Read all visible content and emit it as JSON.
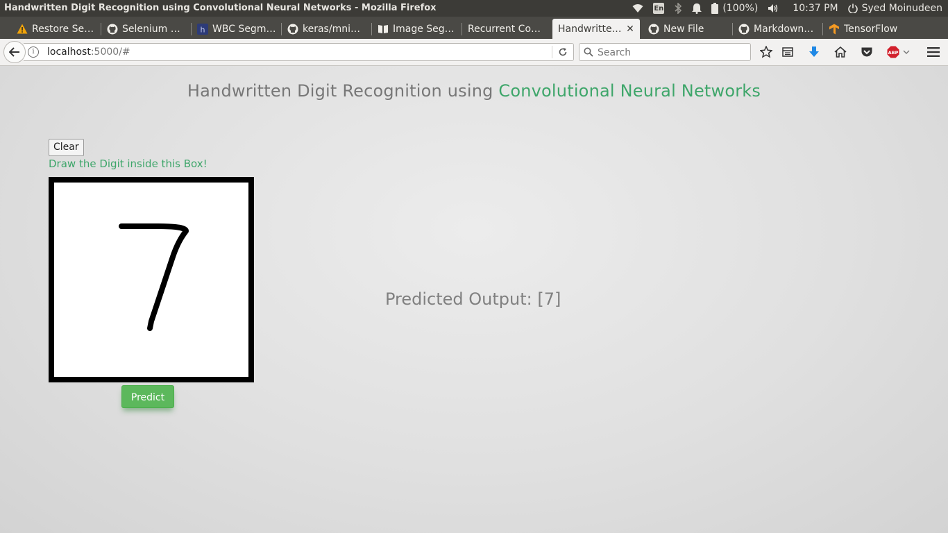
{
  "window": {
    "title": "Handwritten Digit Recognition using Convolutional Neural Networks - Mozilla Firefox"
  },
  "indicators": {
    "keyboard_layout": "En",
    "battery_percent": "(100%)",
    "time": "10:37 PM",
    "user": "Syed Moinudeen",
    "icons": [
      "wifi-icon",
      "keyboard-icon",
      "bluetooth-icon",
      "bell-icon",
      "battery-icon",
      "volume-icon",
      "power-icon"
    ]
  },
  "tabs": [
    {
      "label": "Restore Se…",
      "icon": "warning-icon",
      "active": false
    },
    {
      "label": "Selenium …",
      "icon": "github-icon",
      "active": false
    },
    {
      "label": "WBC Segm…",
      "icon": "h-icon",
      "active": false
    },
    {
      "label": "keras/mni…",
      "icon": "github-icon",
      "active": false
    },
    {
      "label": "Image Seg…",
      "icon": "book-icon",
      "active": false
    },
    {
      "label": "Recurrent Co…",
      "icon": "",
      "active": false
    },
    {
      "label": "Handwritte…",
      "icon": "",
      "active": true
    },
    {
      "label": "New File",
      "icon": "github-icon",
      "active": false
    },
    {
      "label": "Markdown…",
      "icon": "github-icon",
      "active": false
    },
    {
      "label": "TensorFlow",
      "icon": "tensorflow-icon",
      "active": false
    }
  ],
  "toolbar": {
    "url_host": "localhost",
    "url_rest": ":5000/#",
    "search_placeholder": "Search"
  },
  "page": {
    "title_plain": "Handwritten Digit Recognition using ",
    "title_accent": "Convolutional Neural Networks",
    "clear_label": "Clear",
    "draw_hint": "Draw the Digit inside this Box!",
    "predict_label": "Predict",
    "predicted_output": "Predicted Output: [7]"
  },
  "colors": {
    "accent_green": "#3ea66a",
    "predict_button": "#5cb85c",
    "titlebar": "#3c3b37"
  }
}
